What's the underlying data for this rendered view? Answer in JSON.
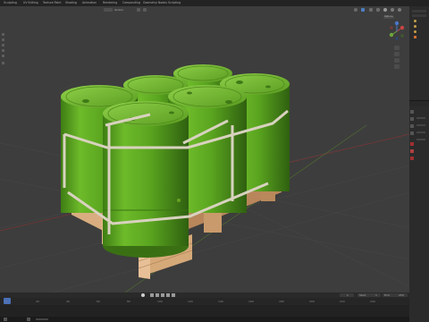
{
  "workspace_tabs": [
    "Sculpting",
    "UV Editing",
    "Texture Paint",
    "Shading",
    "Animation",
    "Rendering",
    "Compositing",
    "Geometry Nodes",
    "Scripting"
  ],
  "viewport": {
    "mode_label": "Global",
    "options_label": "Options",
    "icons": [
      "cursor-icon",
      "move-icon",
      "rotate-icon",
      "scale-icon",
      "transform-icon",
      "measure-icon",
      "camera-icon",
      "hand-icon",
      "grid-icon"
    ]
  },
  "timeline": {
    "frame_ticks": [
      "0",
      "20",
      "40",
      "60",
      "80",
      "100",
      "120",
      "140",
      "160",
      "180",
      "200",
      "220",
      "240"
    ],
    "start_label": "Start",
    "start_value": "1",
    "end_label": "End",
    "end_value": "250",
    "current_frame": "1"
  },
  "colors": {
    "barrel_green": "#5aa51f",
    "barrel_dark": "#3f7a16",
    "band": "#d8d2bf",
    "pallet": "#d2a57b",
    "viewport_bg": "#3d3d3d"
  }
}
